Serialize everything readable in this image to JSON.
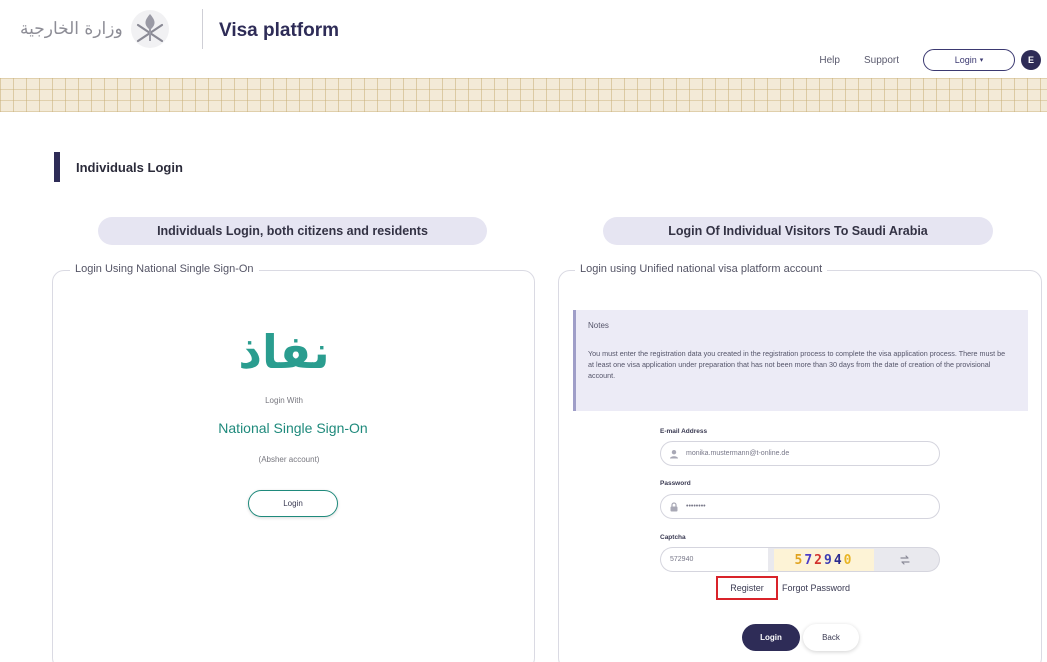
{
  "header": {
    "logo_text": "وزارة الخارجية",
    "platform_title": "Visa platform",
    "nav": {
      "help": "Help",
      "support": "Support",
      "login": "Login",
      "language": "E"
    }
  },
  "page": {
    "title": "Individuals Login"
  },
  "left_section": {
    "pill": "Individuals Login, both citizens and residents",
    "legend": "Login Using National Single Sign-On",
    "logo_text": "نفاذ",
    "login_with": "Login With",
    "provider_name": "National Single Sign-On",
    "absher": "(Absher account)",
    "login_button": "Login"
  },
  "right_section": {
    "pill": "Login Of Individual Visitors To Saudi Arabia",
    "legend": "Login using Unified national visa platform account",
    "notes": {
      "title": "Notes",
      "text": "You must enter the registration data you created in the registration process to complete the visa application process. There must be at least one visa application under preparation that has not been more than 30 days from the date of creation of the provisional account."
    },
    "email": {
      "label": "E-mail Address",
      "value": "monika.mustermann@t-online.de"
    },
    "password": {
      "label": "Password",
      "value": "••••••••"
    },
    "captcha": {
      "label": "Captcha",
      "value": "572940",
      "image_text": "572940"
    },
    "register_link": "Register",
    "forgot_link": "Forgot Password",
    "login_button": "Login",
    "back_button": "Back"
  },
  "colors": {
    "primary": "#2e2c57",
    "accent_green": "#1f8a7c",
    "highlight_red": "#d9232a"
  }
}
